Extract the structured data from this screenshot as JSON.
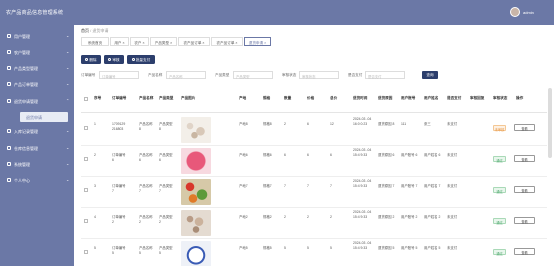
{
  "header": {
    "title": "农产品商品信息管理系统",
    "user": "admin"
  },
  "sidebar": {
    "items": [
      {
        "label": "用户管理"
      },
      {
        "label": "农户管理"
      },
      {
        "label": "产品类型管理"
      },
      {
        "label": "产品订单管理"
      },
      {
        "label": "退货申请管理"
      },
      {
        "label": "入库记录管理"
      },
      {
        "label": "仓库信息管理"
      },
      {
        "label": "系统管理"
      },
      {
        "label": "个人中心"
      }
    ],
    "active_sub": "退货申请"
  },
  "breadcrumb": {
    "home": "首页",
    "sep": "/",
    "current": "退货申请"
  },
  "tabs": [
    {
      "label": "系统首页"
    },
    {
      "label": "用户 ×"
    },
    {
      "label": "农户 ×"
    },
    {
      "label": "产品类型 ×"
    },
    {
      "label": "农产品订单 ×"
    },
    {
      "label": "农产品订单 ×"
    },
    {
      "label": "退货申请 ×"
    }
  ],
  "toolbar": {
    "delete": "删除",
    "audit": "审核",
    "batch_pay": "批量支付"
  },
  "search": {
    "fields": [
      {
        "label": "订单编号",
        "placeholder": "订单编号"
      },
      {
        "label": "产品名称",
        "placeholder": "产品名称"
      },
      {
        "label": "产品类型",
        "placeholder": "产品类型"
      },
      {
        "label": "审核状态",
        "placeholder": "审核状态"
      },
      {
        "label": "是否支付",
        "placeholder": "是否支付"
      }
    ],
    "button": "查询"
  },
  "table": {
    "headers": [
      "序号",
      "订单编号",
      "产品名称",
      "产品类型",
      "产品图片",
      "产地",
      "规格",
      "数量",
      "价格",
      "总价",
      "退货时间",
      "退货原因",
      "用户账号",
      "用户姓名",
      "是否支付",
      "审核回复",
      "审核状态",
      "操作"
    ],
    "rows": [
      {
        "no": "1",
        "order": "1709129 216803",
        "name": "产品名称 8",
        "type": "产品类型 8",
        "origin": "产地8",
        "spec": "规格8",
        "qty": "2",
        "price": "6",
        "total": "12",
        "time": "2024-03 -04 16:0 0:23",
        "reason": "退货原因 8",
        "account": "111",
        "username": "张三",
        "paid": "未支付",
        "reply": "",
        "status": "未审核",
        "status_type": "warn",
        "action": "查看"
      },
      {
        "no": "2",
        "order": "订单编号 6",
        "name": "产品名称 6",
        "type": "产品类型 6",
        "origin": "产地6",
        "spec": "规格6",
        "qty": "6",
        "price": "6",
        "total": "6",
        "time": "2024-03 -04 15:4 9:33",
        "reason": "退货原因 6",
        "account": "用户账号 6",
        "username": "用户姓名 6",
        "paid": "未支付",
        "reply": "",
        "status": "通过",
        "status_type": "ok",
        "action": "查看"
      },
      {
        "no": "3",
        "order": "订单编号 7",
        "name": "产品名称 7",
        "type": "产品类型 7",
        "origin": "产地7",
        "spec": "规格7",
        "qty": "7",
        "price": "7",
        "total": "7",
        "time": "2024-03 -04 15:4 9:33",
        "reason": "退货原因 7",
        "account": "用户账号 7",
        "username": "用户姓名 7",
        "paid": "未支付",
        "reply": "",
        "status": "通过",
        "status_type": "ok",
        "action": "查看"
      },
      {
        "no": "4",
        "order": "订单编号 2",
        "name": "产品名称 2",
        "type": "产品类型 2",
        "origin": "产地2",
        "spec": "规格2",
        "qty": "2",
        "price": "2",
        "total": "2",
        "time": "2024-03 -04 15:4 9:33",
        "reason": "退货原因 2",
        "account": "用户账号 2",
        "username": "用户姓名 2",
        "paid": "未支付",
        "reply": "",
        "status": "通过",
        "status_type": "ok",
        "action": "查看"
      },
      {
        "no": "5",
        "order": "订单编号 5",
        "name": "产品名称 5",
        "type": "产品类型 5",
        "origin": "产地5",
        "spec": "规格5",
        "qty": "5",
        "price": "5",
        "total": "5",
        "time": "2024-03 -04 15:4 9:33",
        "reason": "退货原因 5",
        "account": "用户账号 5",
        "username": "用户姓名 5",
        "paid": "未支付",
        "reply": "",
        "status": "通过",
        "status_type": "ok",
        "action": "查看"
      }
    ]
  },
  "colors": {
    "primary": "#6b78a6",
    "button": "#2c3e6c",
    "warn": "#e69440",
    "ok": "#4aa56a"
  }
}
